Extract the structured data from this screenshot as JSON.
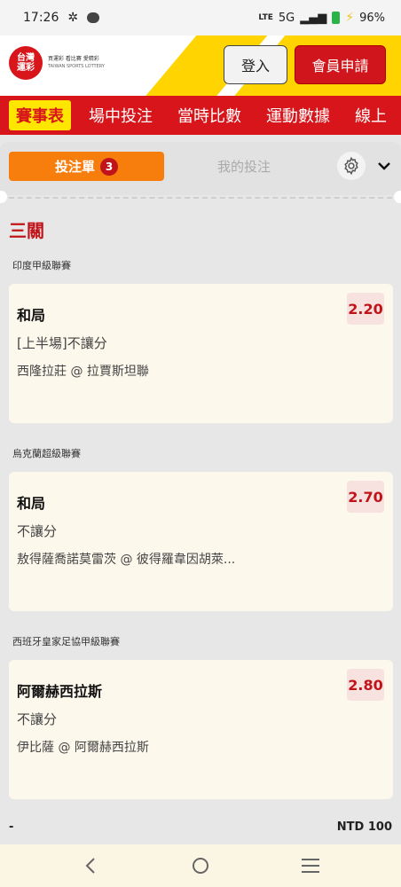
{
  "status": {
    "time": "17:26",
    "signal": "5G",
    "lte": "LTE",
    "battery": "96%"
  },
  "header": {
    "logo_mark": "台灣\n運彩",
    "logo_line1": "買運彩 看比賽 愛精彩",
    "logo_line2": "TAIWAN SPORTS LOTTERY",
    "login_label": "登入",
    "join_label": "會員申請"
  },
  "nav": {
    "items": [
      "賽事表",
      "場中投注",
      "當時比數",
      "運動數據",
      "線上"
    ]
  },
  "betslip": {
    "tab_bet": "投注單",
    "bet_count": "3",
    "tab_mine": "我的投注",
    "parlay_label": "三關",
    "bets": [
      {
        "league": "印度甲級聯賽",
        "selection": "和局",
        "odds": "2.20",
        "market": "[上半場]不讓分",
        "match": "西隆拉莊 @ 拉賈斯坦聯"
      },
      {
        "league": "烏克蘭超級聯賽",
        "selection": "和局",
        "odds": "2.70",
        "market": "不讓分",
        "match": "敖得薩喬諾莫雷茨 @ 彼得羅韋因胡萊..."
      },
      {
        "league": "西班牙皇家足協甲級聯賽",
        "selection": "阿爾赫西拉斯",
        "odds": "2.80",
        "market": "不讓分",
        "match": "伊比薩 @ 阿爾赫西拉斯"
      }
    ],
    "footer_left": "-",
    "footer_amount": "NTD 100"
  },
  "icons": {
    "gear": "gear-icon",
    "chevron": "chevron-down-icon"
  },
  "colors": {
    "brand_red": "#d7151b",
    "accent_orange": "#f77d0d",
    "yellow": "#ffe600"
  }
}
